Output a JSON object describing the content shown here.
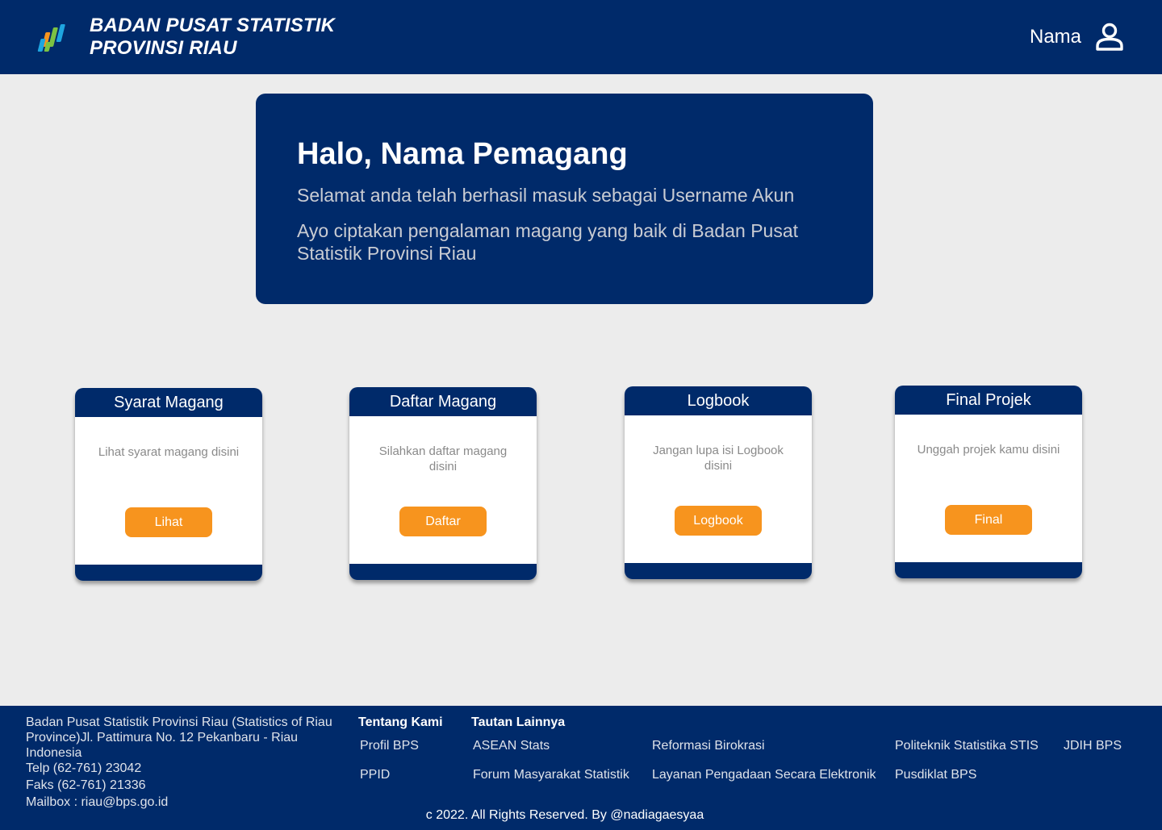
{
  "header": {
    "org_line1": "BADAN PUSAT STATISTIK",
    "org_line2": "PROVINSI RIAU",
    "user_name": "Nama",
    "user_icon": "user-icon",
    "logo_icon": "bps-logo"
  },
  "hero": {
    "title": "Halo, Nama Pemagang",
    "line1": "Selamat anda telah berhasil masuk sebagai Username Akun",
    "line2": "Ayo ciptakan pengalaman magang yang baik di Badan Pusat Statistik Provinsi Riau"
  },
  "cards": [
    {
      "title": "Syarat Magang",
      "desc": "Lihat syarat magang disini",
      "button": "Lihat"
    },
    {
      "title": "Daftar Magang",
      "desc": "Silahkan daftar magang disini",
      "button": "Daftar"
    },
    {
      "title": "Logbook",
      "desc": "Jangan lupa isi Logbook disini",
      "button": "Logbook"
    },
    {
      "title": "Final Projek",
      "desc": "Unggah projek kamu disini",
      "button": "Final"
    }
  ],
  "footer": {
    "address": "Badan Pusat Statistik Provinsi Riau (Statistics of Riau Province)Jl. Pattimura No. 12 Pekanbaru - Riau Indonesia",
    "phone": "Telp (62-761) 23042",
    "fax": "Faks (62-761) 21336",
    "mailbox": "Mailbox : riau@bps.go.id",
    "about_heading": "Tentang Kami",
    "about_links": [
      "Profil BPS",
      "PPID"
    ],
    "other_heading": "Tautan Lainnya",
    "other_links": [
      "ASEAN Stats",
      "Reformasi Birokrasi",
      "Politeknik Statistika STIS",
      "JDIH BPS",
      "Forum Masyarakat Statistik",
      "Layanan Pengadaan Secara Elektronik",
      "Pusdiklat BPS"
    ],
    "copyright": "c 2022. All Rights Reserved. By @nadiagaesyaa"
  },
  "colors": {
    "primary_navy": "#002a6a",
    "accent_orange": "#f7941e",
    "page_background": "#ececec"
  }
}
